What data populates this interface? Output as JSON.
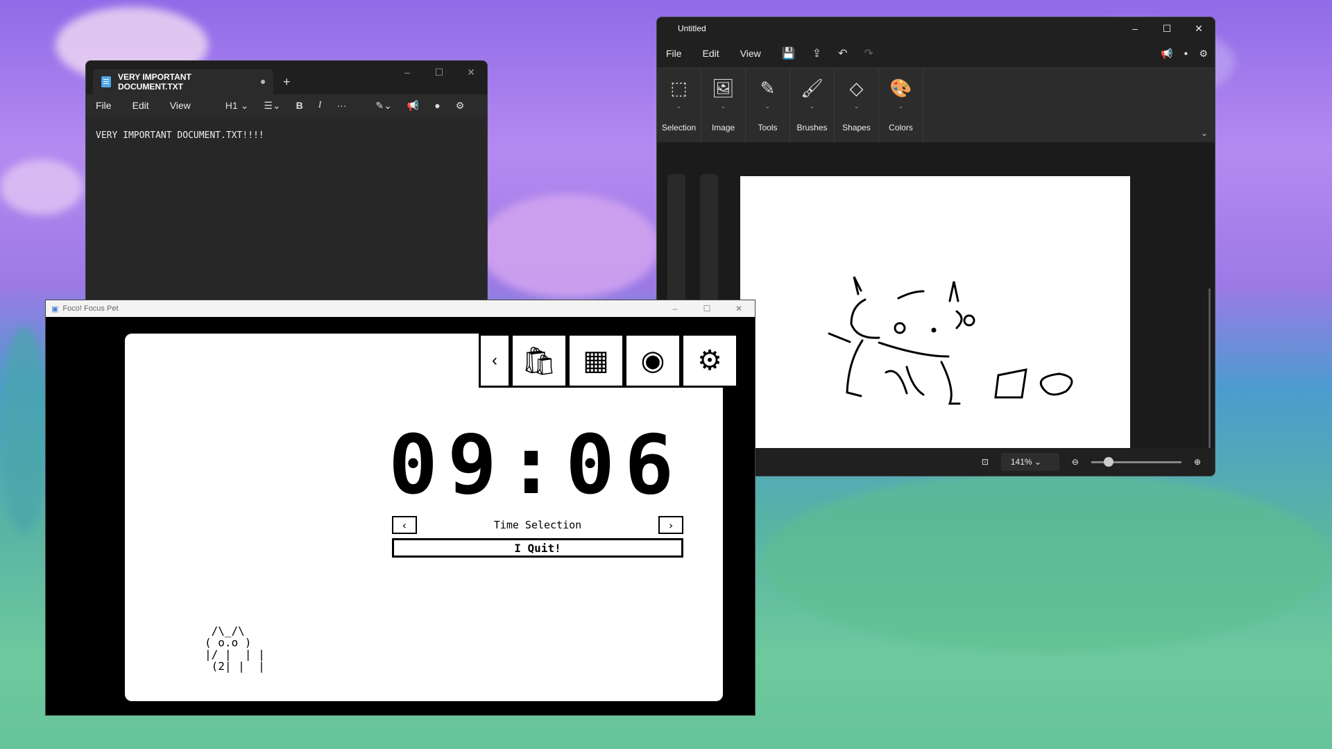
{
  "notepad": {
    "tab_title": "VERY IMPORTANT DOCUMENT.TXT",
    "menu": [
      "File",
      "Edit",
      "View"
    ],
    "heading_selector": "H1",
    "bold": "B",
    "italic": "I",
    "more": "···",
    "content": "VERY IMPORTANT DOCUMENT.TXT!!!!"
  },
  "paint": {
    "title": "Untitled",
    "menu": [
      "File",
      "Edit",
      "View"
    ],
    "ribbon": [
      "Selection",
      "Image",
      "Tools",
      "Brushes",
      "Shapes",
      "Colors"
    ],
    "zoom": "141%"
  },
  "focus": {
    "title": "Foco! Focus Pet",
    "timer": "09:06",
    "time_selection": "Time Selection",
    "quit": "I Quit!",
    "cat_number": "2"
  }
}
